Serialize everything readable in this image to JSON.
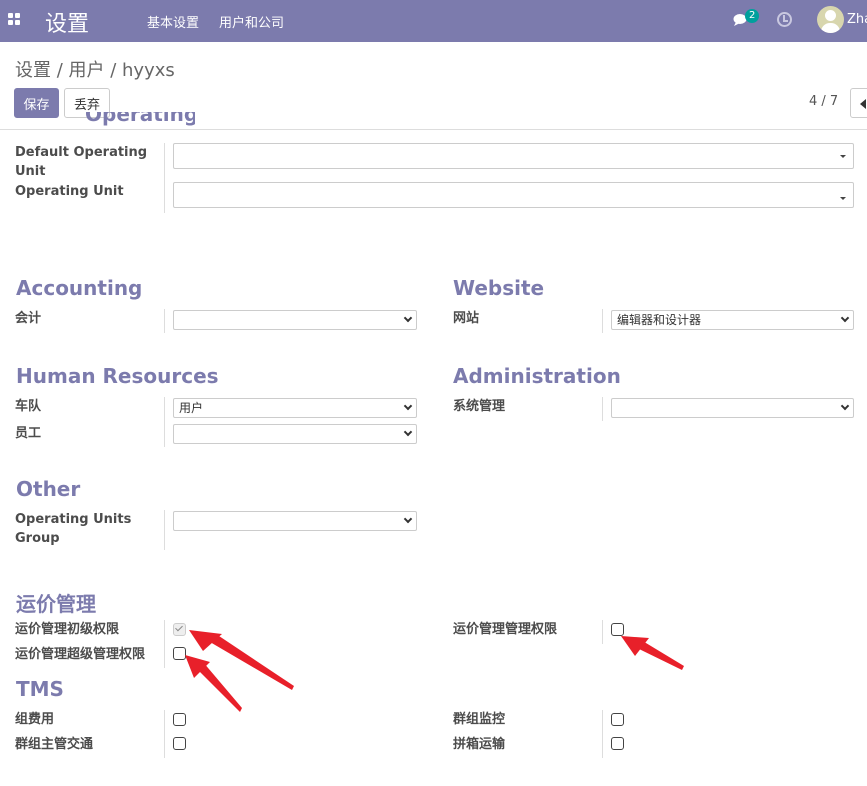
{
  "topbar": {
    "brand": "设置",
    "menu": [
      "基本设置",
      "用户和公司"
    ],
    "chat_badge": "2",
    "user_name": "Zha"
  },
  "breadcrumb": "设置 / 用户 / hyyxs",
  "toolbar": {
    "save_label": "保存",
    "discard_label": "丢弃",
    "pager": "4 / 7"
  },
  "operating_unit": {
    "default_label": "Default Operating Unit",
    "unit_label": "Operating Unit"
  },
  "accounting": {
    "title": "Accounting",
    "field_label": "会计",
    "value": ""
  },
  "website": {
    "title": "Website",
    "field_label": "网站",
    "value": "编辑器和设计器"
  },
  "human_resources": {
    "title": "Human Resources",
    "fleet_label": "车队",
    "fleet_value": "用户",
    "employee_label": "员工",
    "employee_value": ""
  },
  "administration": {
    "title": "Administration",
    "field_label": "系统管理",
    "value": ""
  },
  "other": {
    "title": "Other",
    "field_label": "Operating Units Group",
    "value": ""
  },
  "freight": {
    "title": "运价管理",
    "basic_label": "运价管理初级权限",
    "basic_checked": true,
    "super_label": "运价管理超级管理权限",
    "super_checked": false,
    "manage_label": "运价管理管理权限",
    "manage_checked": false
  },
  "tms": {
    "title": "TMS",
    "group_fee_label": "组费用",
    "group_fee_checked": false,
    "group_monitor_label": "群组监控",
    "group_monitor_checked": false,
    "group_traffic_label": "群组主管交通",
    "group_traffic_checked": false,
    "lcl_label": "拼箱运输",
    "lcl_checked": false
  },
  "colors": {
    "primary": "#7c7bad",
    "badge": "#00a09d",
    "arrow": "#e8202a"
  }
}
